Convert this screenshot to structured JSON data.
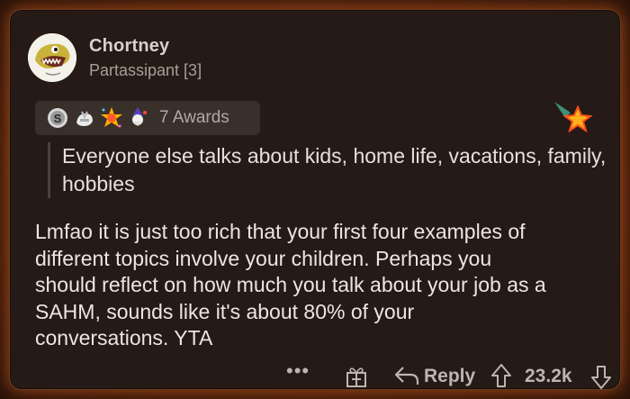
{
  "comment": {
    "username": "Chortney",
    "flair": "Partassipant [3]",
    "awards_count_label": "7 Awards",
    "award_icons": [
      "silver-award-icon",
      "wholesome-award-icon",
      "starstruck-award-icon",
      "wizard-award-icon"
    ],
    "featured_award_icon": "rising-star-award-icon",
    "quote": "Everyone else talks about kids, home life, vacations, family, hobbies",
    "body_lines": [
      "Lmfao it is just too rich that your first four examples of",
      "different topics involve your children. Perhaps you",
      "should reflect on how much you talk about your job as a",
      "SAHM, sounds like it's about 80% of your",
      "conversations. YTA"
    ]
  },
  "actions": {
    "more": "•••",
    "reply_label": "Reply",
    "score": "23.2k"
  },
  "colors": {
    "card_bg": "#251a15",
    "glow": "#ff7828",
    "text": "#ece6e1",
    "muted": "#a89f98"
  }
}
